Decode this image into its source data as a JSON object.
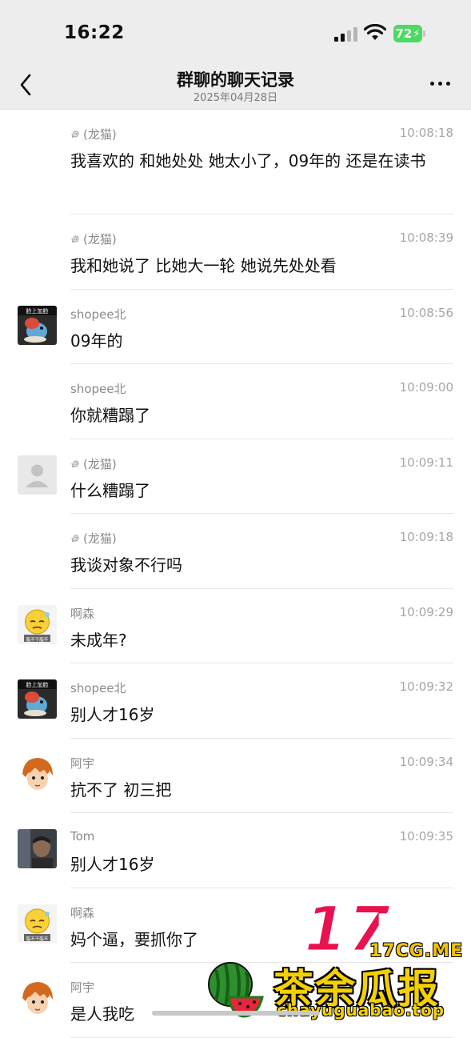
{
  "status_bar": {
    "time": "16:22",
    "battery": "72"
  },
  "header": {
    "title": "群聊的聊天记录",
    "date": "2025年04月28日",
    "back_icon": "chevron-left-icon",
    "more_icon": "more-dots-icon"
  },
  "messages": [
    {
      "sender": "(龙猫)",
      "time": "10:08:18",
      "text": "我喜欢的  和她处处 她太小了，09年的 还是在读书",
      "avatar": "none",
      "sender_icon": "swirl-icon"
    },
    {
      "sender": "(龙猫)",
      "time": "10:08:39",
      "text": "我和她说了  比她大一轮  她说先处处看",
      "avatar": "none",
      "sender_icon": "swirl-icon"
    },
    {
      "sender": "shopee北",
      "time": "10:08:56",
      "text": "09年的",
      "avatar": "cartoon-avatar"
    },
    {
      "sender": "shopee北",
      "time": "10:09:00",
      "text": "你就糟蹋了",
      "avatar": "none"
    },
    {
      "sender": "(龙猫)",
      "time": "10:09:11",
      "text": "什么糟蹋了",
      "avatar": "default-avatar",
      "sender_icon": "swirl-icon"
    },
    {
      "sender": "(龙猫)",
      "time": "10:09:18",
      "text": "我谈对象不行吗",
      "avatar": "none",
      "sender_icon": "swirl-icon"
    },
    {
      "sender": "啊森",
      "time": "10:09:29",
      "text": "未成年?",
      "avatar": "emoji-avatar"
    },
    {
      "sender": "shopee北",
      "time": "10:09:32",
      "text": "别人才16岁",
      "avatar": "cartoon-avatar"
    },
    {
      "sender": "阿宇",
      "time": "10:09:34",
      "text": "抗不了 初三把",
      "avatar": "anime-avatar"
    },
    {
      "sender": "Tom",
      "time": "10:09:35",
      "text": "别人才16岁",
      "avatar": "photo-avatar"
    },
    {
      "sender": "啊森",
      "time": "",
      "text": "妈个逼，要抓你了",
      "avatar": "emoji-avatar"
    },
    {
      "sender": "阿宇",
      "time": "",
      "text": "是人我吃",
      "avatar": "anime-avatar"
    }
  ],
  "watermark": {
    "logo": "17吃瓜",
    "site1": "17CG.ME",
    "name": "茶余瓜报",
    "site2": "chayuguabao.top"
  },
  "colors": {
    "header_bg": "#ededed",
    "battery": "#4cd964",
    "watermark_yellow": "#f5d000",
    "watermark_red": "#e8124e"
  }
}
